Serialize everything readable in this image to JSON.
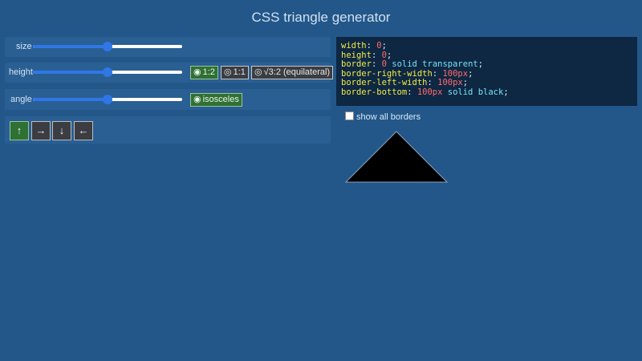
{
  "title": "CSS triangle generator",
  "controls": {
    "size": {
      "label": "size",
      "value_fraction": 0.5
    },
    "height": {
      "label": "height",
      "value_fraction": 0.5,
      "options": [
        {
          "glyph": "◉",
          "label": "1:2",
          "selected": true
        },
        {
          "glyph": "◎",
          "label": "1:1",
          "selected": false
        },
        {
          "glyph": "◎",
          "label": "√3:2 (equilateral)",
          "selected": false
        }
      ]
    },
    "angle": {
      "label": "angle",
      "value_fraction": 0.5,
      "options": [
        {
          "glyph": "◉",
          "label": "isosceles",
          "selected": true
        }
      ]
    },
    "directions": [
      {
        "label": "↑",
        "selected": true
      },
      {
        "label": "→",
        "selected": false
      },
      {
        "label": "↓",
        "selected": false
      },
      {
        "label": "←",
        "selected": false
      }
    ]
  },
  "code": [
    {
      "prop": "width",
      "parts": [
        {
          "text": "0",
          "kind": "n"
        }
      ]
    },
    {
      "prop": "height",
      "parts": [
        {
          "text": "0",
          "kind": "n"
        }
      ]
    },
    {
      "prop": "border",
      "parts": [
        {
          "text": "0",
          "kind": "n"
        },
        {
          "text": " solid transparent",
          "kind": "v"
        }
      ]
    },
    {
      "prop": "border-right-width",
      "parts": [
        {
          "text": "100px",
          "kind": "n"
        }
      ]
    },
    {
      "prop": "border-left-width",
      "parts": [
        {
          "text": "100px",
          "kind": "n"
        }
      ]
    },
    {
      "prop": "border-bottom",
      "parts": [
        {
          "text": "100px",
          "kind": "n"
        },
        {
          "text": " solid black",
          "kind": "v"
        }
      ]
    }
  ],
  "show_all_borders": {
    "label": "show all borders",
    "checked": false
  },
  "preview": {
    "color": "#000000"
  }
}
